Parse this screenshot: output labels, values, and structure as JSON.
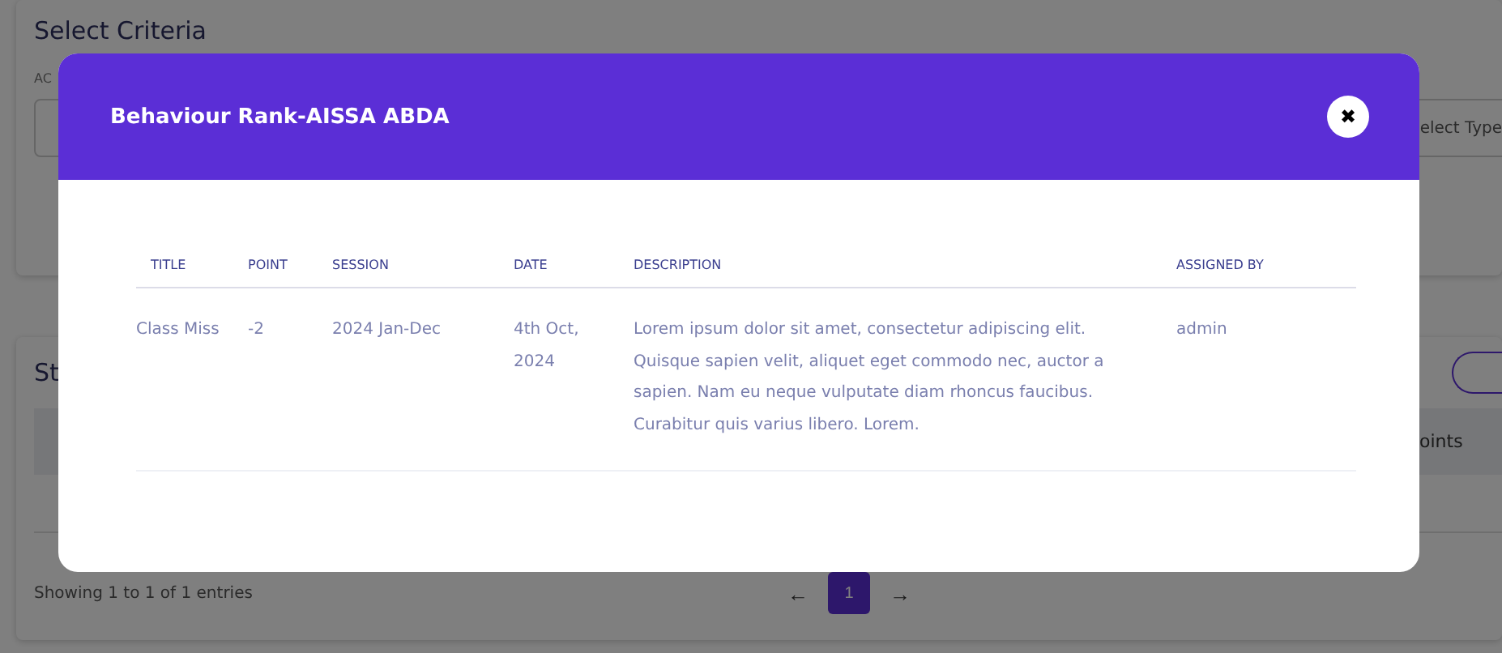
{
  "background": {
    "criteria_card": {
      "title": "Select Criteria",
      "field_label": "AC",
      "type_select": {
        "placeholder": "elect Type"
      }
    },
    "list_card": {
      "title": "St",
      "header_cell": "oints",
      "footer": "Showing 1 to 1 of 1 entries",
      "pagination": {
        "prev": "←",
        "next": "→",
        "pages": [
          {
            "label": "1",
            "selected": true
          }
        ]
      }
    }
  },
  "modal": {
    "title": "Behaviour Rank-AISSA ABDA",
    "close": "✖",
    "table": {
      "columns": [
        "TITLE",
        "POINT",
        "SESSION",
        "DATE",
        "DESCRIPTION",
        "ASSIGNED BY"
      ],
      "rows": [
        [
          "Class Miss",
          "-2",
          "2024 Jan-Dec",
          "4th Oct, 2024",
          "Lorem ipsum dolor sit amet, consectetur adipiscing elit. Quisque sapien velit, aliquet eget commodo nec, auctor a sapien. Nam eu neque vulputate diam rhoncus faucibus. Curabitur quis varius libero. Lorem.",
          "admin"
        ]
      ]
    }
  }
}
